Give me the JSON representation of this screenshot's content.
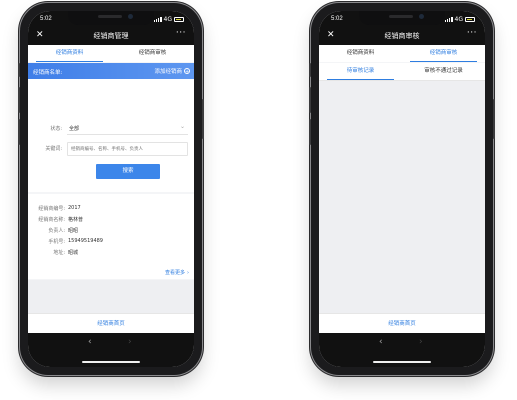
{
  "left_phone": {
    "status": {
      "time": "5:02",
      "network": "4G"
    },
    "nav": {
      "close": "✕",
      "title": "经销商管理",
      "more": "···"
    },
    "tabs": [
      {
        "label": "经销商资料",
        "active": true
      },
      {
        "label": "经销商审核",
        "active": false
      }
    ],
    "banner": {
      "label": "经销商名单:",
      "add": "添加经销商",
      "add_icon": "plus-circle-icon"
    },
    "form": {
      "status_label": "状态:",
      "status_value": "全部",
      "keyword_label": "关键词:",
      "keyword_placeholder": "经销商编号、名称、手机号、负责人",
      "search_button": "搜索"
    },
    "detail": {
      "rows": [
        {
          "key": "经销商编号:",
          "value": "2017"
        },
        {
          "key": "经销商名称:",
          "value": "格林普"
        },
        {
          "key": "负责人:",
          "value": "昭昭"
        },
        {
          "key": "手机号:",
          "value": "15949519489"
        },
        {
          "key": "地址:",
          "value": "昭城"
        }
      ],
      "view_more": "查看更多"
    },
    "footer": "经销商首页",
    "browser": {
      "back": "‹",
      "forward": "›"
    }
  },
  "right_phone": {
    "status": {
      "time": "5:02",
      "network": "4G"
    },
    "nav": {
      "close": "✕",
      "title": "经销商审核",
      "more": "···"
    },
    "tabs": [
      {
        "label": "经销商资料",
        "active": false
      },
      {
        "label": "经销商审核",
        "active": true
      }
    ],
    "subtabs": [
      {
        "label": "待审核记录",
        "active": true
      },
      {
        "label": "审核不通过记录",
        "active": false
      }
    ],
    "footer": "经销商首页",
    "browser": {
      "back": "‹",
      "forward": "›"
    }
  },
  "colors": {
    "accent": "#2e7de0",
    "banner": "#3f7ee8",
    "dark": "#111111",
    "battery": "#d7d339"
  }
}
